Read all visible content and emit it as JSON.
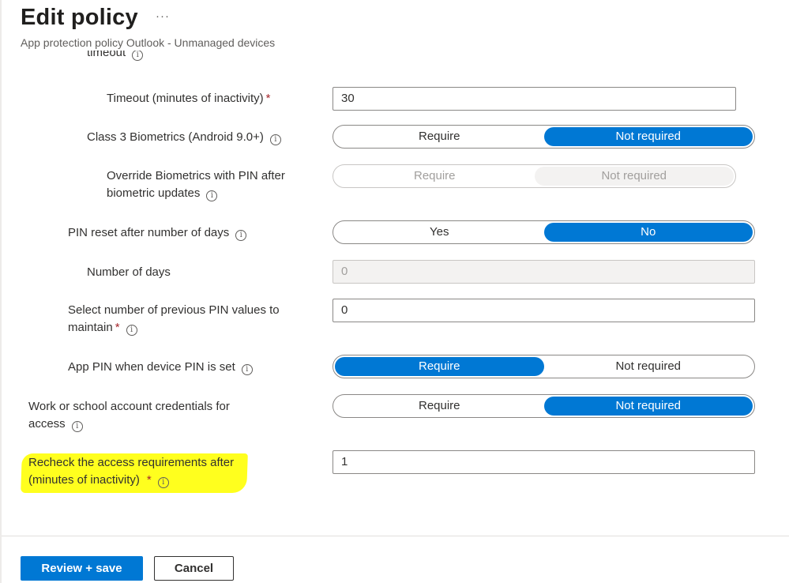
{
  "header": {
    "title": "Edit policy",
    "more_label": "···",
    "subtitle": "App protection policy Outlook - Unmanaged devices"
  },
  "form": {
    "clipped_label": "timeout",
    "timeout": {
      "label": "Timeout (minutes of inactivity)",
      "required": "*",
      "value": "30"
    },
    "class3_biometrics": {
      "label": "Class 3 Biometrics (Android 9.0+)",
      "options": [
        "Require",
        "Not required"
      ],
      "selected": "Not required"
    },
    "override_biometrics": {
      "label_line1": "Override Biometrics with PIN after",
      "label_line2": "biometric updates",
      "options": [
        "Require",
        "Not required"
      ],
      "selected": "Not required",
      "disabled": true
    },
    "pin_reset": {
      "label": "PIN reset after number of days",
      "options": [
        "Yes",
        "No"
      ],
      "selected": "No"
    },
    "number_of_days": {
      "label": "Number of days",
      "value": "0",
      "disabled": true
    },
    "previous_pins": {
      "label_line1": "Select number of previous PIN values to",
      "label_line2": "maintain",
      "required": "*",
      "value": "0"
    },
    "app_pin": {
      "label": "App PIN when device PIN is set",
      "options": [
        "Require",
        "Not required"
      ],
      "selected": "Require"
    },
    "work_credentials": {
      "label_line1": "Work or school account credentials for",
      "label_line2": "access",
      "options": [
        "Require",
        "Not required"
      ],
      "selected": "Not required"
    },
    "recheck": {
      "label_line1": "Recheck the access requirements after",
      "label_line2": "(minutes of inactivity)",
      "required": "*",
      "value": "1",
      "highlight_color": "#ffff1e"
    }
  },
  "footer": {
    "primary_label": "Review + save",
    "secondary_label": "Cancel"
  },
  "colors": {
    "accent": "#0078d4",
    "required": "#a4262c",
    "highlight": "#ffff1e"
  },
  "icons": {
    "info": "info-icon"
  }
}
